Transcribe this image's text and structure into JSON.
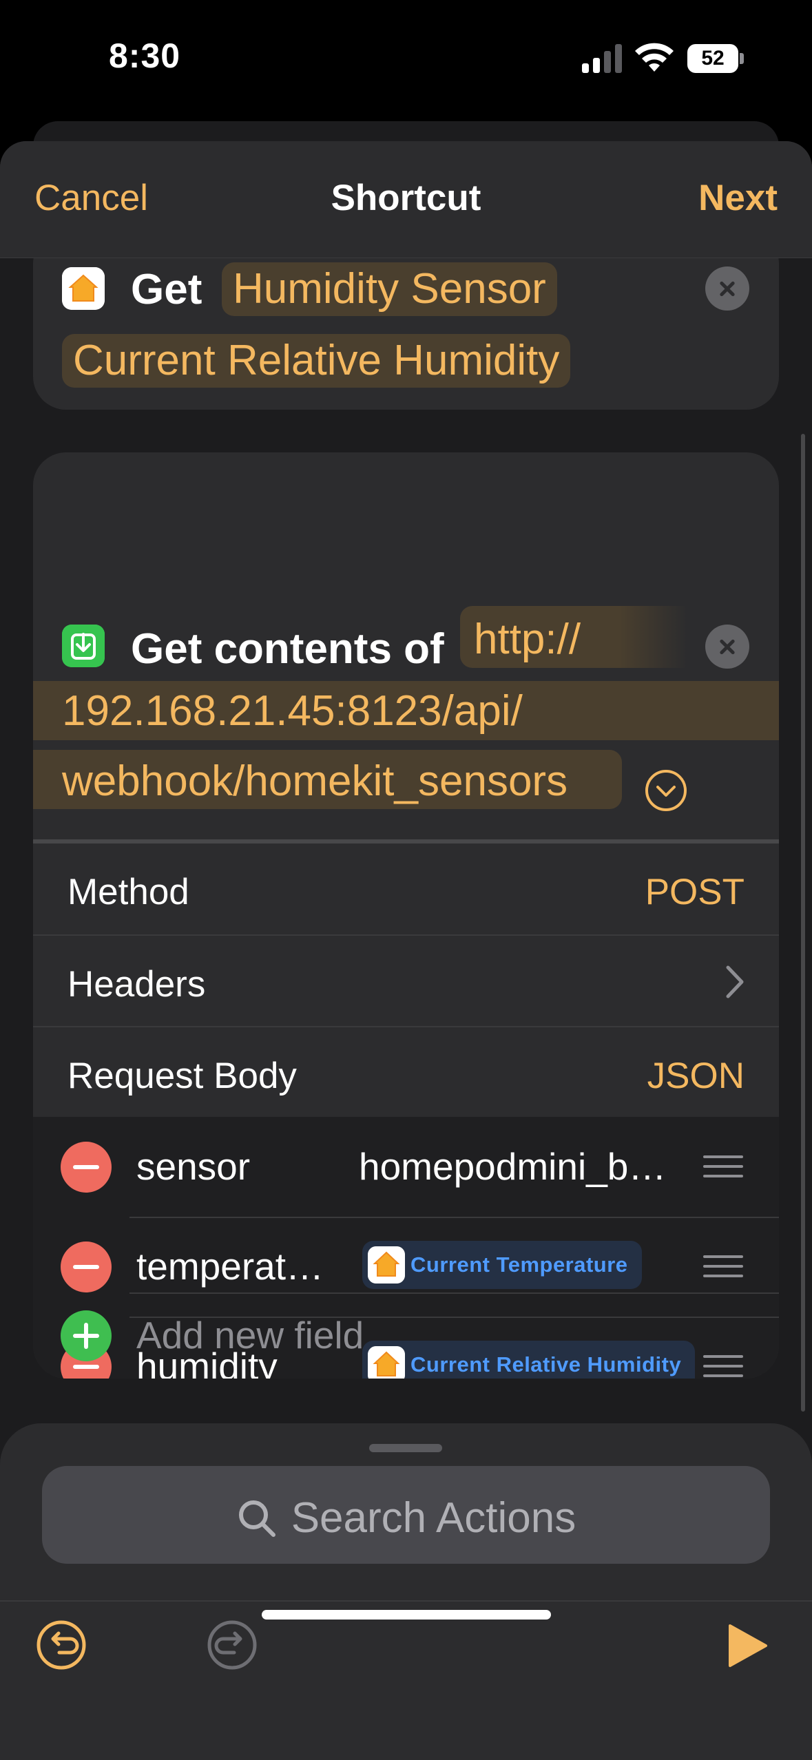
{
  "status": {
    "time": "8:30",
    "battery": "52"
  },
  "nav": {
    "cancel": "Cancel",
    "title": "Shortcut",
    "next": "Next"
  },
  "action_get": {
    "verb": "Get",
    "device": "Humidity Sensor",
    "characteristic": "Current Relative Humidity"
  },
  "action_contents": {
    "label": "Get contents of",
    "url_part1": "http://",
    "url_part2": "192.168.21.45:8123/api/",
    "url_part3": "webhook/homekit_sensors",
    "method": {
      "label": "Method",
      "value": "POST"
    },
    "headers": {
      "label": "Headers"
    },
    "body": {
      "label": "Request Body",
      "value": "JSON"
    },
    "fields": [
      {
        "key": "sensor",
        "value": "homepodmini_b…",
        "type": "text"
      },
      {
        "key": "temperat…",
        "value": "Current Temperature",
        "type": "variable"
      },
      {
        "key": "humidity",
        "value": "Current Relative Humidity",
        "type": "variable"
      }
    ],
    "add_field": "Add new field"
  },
  "search": {
    "placeholder": "Search Actions"
  },
  "colors": {
    "accent": "#f4b860",
    "variable": "#4f9bff",
    "remove": "#ef6b5f",
    "add": "#3fbe50"
  },
  "icons": [
    "home-app-icon",
    "download-icon",
    "close-icon",
    "chevron-down-circle-icon",
    "chevron-right-icon",
    "drag-handle-icon",
    "search-icon",
    "undo-icon",
    "redo-icon",
    "play-icon"
  ]
}
